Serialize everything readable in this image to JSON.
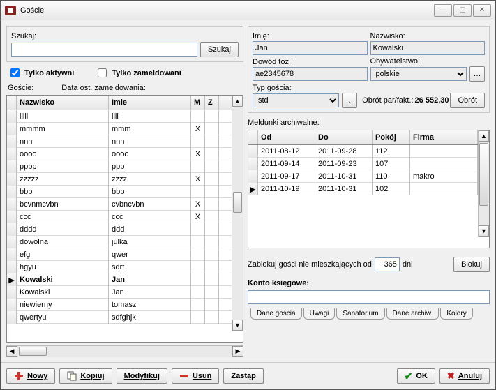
{
  "window": {
    "title": "Goście"
  },
  "search": {
    "label": "Szukaj:",
    "value": "",
    "button": "Szukaj"
  },
  "filters": {
    "only_active": {
      "label": "Tylko aktywni",
      "checked": true
    },
    "only_registered": {
      "label": "Tylko zameldowani",
      "checked": false
    },
    "guests_label": "Goście:",
    "last_checkin_label": "Data ost. zameldowania:"
  },
  "guest_grid": {
    "columns": {
      "surname": "Nazwisko",
      "name": "Imie",
      "m": "M",
      "z": "Z"
    },
    "rows": [
      {
        "mark": "",
        "surname": "lllll",
        "name": "llll",
        "m": "",
        "z": ""
      },
      {
        "mark": "",
        "surname": "mmmm",
        "name": "mmm",
        "m": "X",
        "z": ""
      },
      {
        "mark": "",
        "surname": "nnn",
        "name": "nnn",
        "m": "",
        "z": ""
      },
      {
        "mark": "",
        "surname": "oooo",
        "name": "oooo",
        "m": "X",
        "z": ""
      },
      {
        "mark": "",
        "surname": "pppp",
        "name": "ppp",
        "m": "",
        "z": ""
      },
      {
        "mark": "",
        "surname": "zzzzz",
        "name": "zzzz",
        "m": "X",
        "z": ""
      },
      {
        "mark": "",
        "surname": "bbb",
        "name": "bbb",
        "m": "",
        "z": ""
      },
      {
        "mark": "",
        "surname": "bcvnmcvbn",
        "name": "cvbncvbn",
        "m": "X",
        "z": ""
      },
      {
        "mark": "",
        "surname": "ccc",
        "name": "ccc",
        "m": "X",
        "z": ""
      },
      {
        "mark": "",
        "surname": "dddd",
        "name": "ddd",
        "m": "",
        "z": ""
      },
      {
        "mark": "",
        "surname": "dowolna",
        "name": "julka",
        "m": "",
        "z": ""
      },
      {
        "mark": "",
        "surname": "efg",
        "name": "qwer",
        "m": "",
        "z": ""
      },
      {
        "mark": "",
        "surname": "hgyu",
        "name": "sdrt",
        "m": "",
        "z": ""
      },
      {
        "mark": "▶",
        "surname": "Kowalski",
        "name": "Jan",
        "m": "",
        "z": ""
      },
      {
        "mark": "",
        "surname": "Kowalski",
        "name": "Jan",
        "m": "",
        "z": ""
      },
      {
        "mark": "",
        "surname": "niewierny",
        "name": "tomasz",
        "m": "",
        "z": ""
      },
      {
        "mark": "",
        "surname": "qwertyu",
        "name": "sdfghjk",
        "m": "",
        "z": ""
      }
    ]
  },
  "details": {
    "first_name": {
      "label": "Imię:",
      "value": "Jan"
    },
    "surname": {
      "label": "Nazwisko:",
      "value": "Kowalski"
    },
    "id_doc": {
      "label": "Dowód toż.:",
      "value": "ae2345678"
    },
    "citizenship": {
      "label": "Obywatelstwo:",
      "value": "polskie"
    },
    "guest_type": {
      "label": "Typ gościa:",
      "value": "std"
    },
    "turnover_label": "Obrót par/fakt.:",
    "turnover_value": "26 552,30",
    "turnover_button": "Obrót"
  },
  "archive": {
    "title": "Meldunki archiwalne:",
    "columns": {
      "from": "Od",
      "to": "Do",
      "room": "Pokój",
      "company": "Firma"
    },
    "rows": [
      {
        "mark": "",
        "from": "2011-08-12",
        "to": "2011-09-28",
        "room": "112",
        "company": ""
      },
      {
        "mark": "",
        "from": "2011-09-14",
        "to": "2011-09-23",
        "room": "107",
        "company": ""
      },
      {
        "mark": "",
        "from": "2011-09-17",
        "to": "2011-10-31",
        "room": "110",
        "company": "makro"
      },
      {
        "mark": "▶",
        "from": "2011-10-19",
        "to": "2011-10-31",
        "room": "102",
        "company": ""
      }
    ]
  },
  "block": {
    "label_pre": "Zablokuj gości nie mieszkających od",
    "days": "365",
    "label_post": "dni",
    "button": "Blokuj"
  },
  "account": {
    "label": "Konto księgowe:",
    "value": ""
  },
  "tabs": [
    "Dane gościa",
    "Uwagi",
    "Sanatorium",
    "Dane archiw.",
    "Kolory"
  ],
  "toolbar": {
    "new": "Nowy",
    "copy": "Kopiuj",
    "modify": "Modyfikuj",
    "delete": "Usuń",
    "replace": "Zastąp",
    "ok": "OK",
    "cancel": "Anuluj"
  }
}
